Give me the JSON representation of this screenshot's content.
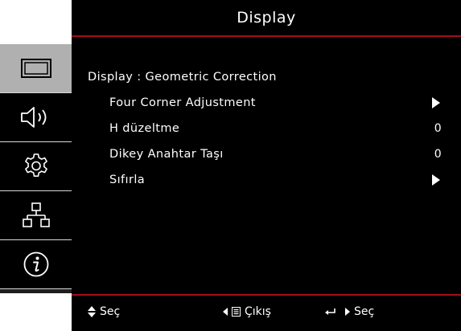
{
  "header": {
    "title": "Display"
  },
  "sidebar": {
    "tabs": [
      {
        "icon": "display-icon",
        "active": true
      },
      {
        "icon": "speaker-icon",
        "active": false
      },
      {
        "icon": "gear-icon",
        "active": false
      },
      {
        "icon": "network-icon",
        "active": false
      },
      {
        "icon": "info-icon",
        "active": false
      }
    ]
  },
  "main": {
    "breadcrumb": "Display : Geometric Correction",
    "rows": [
      {
        "label": "Four Corner Adjustment",
        "value": "",
        "arrow": true
      },
      {
        "label": "H düzeltme",
        "value": "0",
        "arrow": false
      },
      {
        "label": "Dikey Anahtar Taşı",
        "value": "0",
        "arrow": false
      },
      {
        "label": "Sıfırla",
        "value": "",
        "arrow": true
      }
    ]
  },
  "footer": {
    "select_label": "Seç",
    "exit_label": "Çıkış",
    "enter_label": "Seç"
  },
  "colors": {
    "background": "#000000",
    "accent_rule": "#a40e1a",
    "active_tab": "#b0b0b0",
    "text": "#ffffff"
  }
}
